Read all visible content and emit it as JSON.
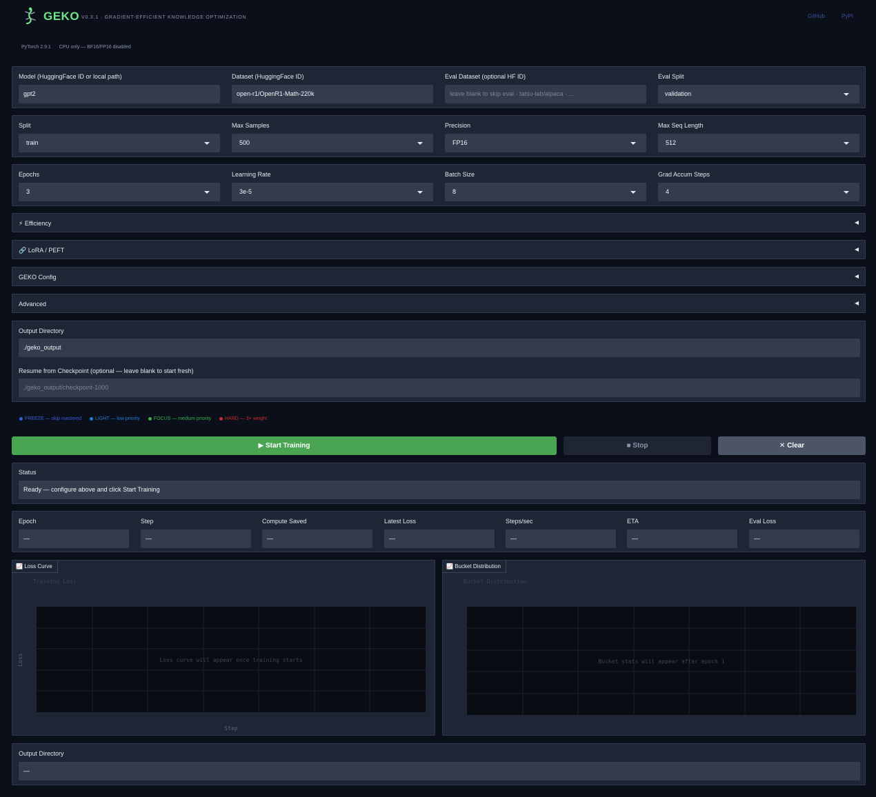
{
  "header": {
    "brand": "GEKO",
    "tagline": "V0.3.1 · GRADIENT-EFFICIENT KNOWLEDGE OPTIMIZATION",
    "links": [
      "GitHub",
      "PyPI"
    ],
    "logo_icon": "gecko-icon",
    "brand_color": "#6ee787"
  },
  "env": {
    "torch": "PyTorch 2.9.1",
    "device": "CPU only — BF16/FP16 disabled"
  },
  "row1": {
    "model": {
      "label": "Model (HuggingFace ID or local path)",
      "value": "gpt2"
    },
    "dataset": {
      "label": "Dataset (HuggingFace ID)",
      "value": "open-r1/OpenR1-Math-220k"
    },
    "eval_dataset": {
      "label": "Eval Dataset (optional HF ID)",
      "value": "",
      "placeholder": "leave blank to skip eval · tatsu-lab/alpaca · ..."
    },
    "eval_split": {
      "label": "Eval Split",
      "value": "validation"
    }
  },
  "row2": {
    "split": {
      "label": "Split",
      "value": "train"
    },
    "max_samples": {
      "label": "Max Samples",
      "value": "500"
    },
    "precision": {
      "label": "Precision",
      "value": "FP16"
    },
    "max_seq": {
      "label": "Max Seq Length",
      "value": "512"
    }
  },
  "row3": {
    "epochs": {
      "label": "Epochs",
      "value": "3"
    },
    "lr": {
      "label": "Learning Rate",
      "value": "3e-5"
    },
    "batch": {
      "label": "Batch Size",
      "value": "8"
    },
    "grad_accum": {
      "label": "Grad Accum Steps",
      "value": "4"
    }
  },
  "accordions": [
    {
      "icon": "⚡",
      "label": "Efficiency"
    },
    {
      "icon": "🔗",
      "label": "LoRA / PEFT"
    },
    {
      "icon": "",
      "label": "GEKO Config"
    },
    {
      "icon": "",
      "label": "Advanced"
    }
  ],
  "output": {
    "dir_label": "Output Directory",
    "dir_value": "./geko_output",
    "resume_label": "Resume from Checkpoint (optional — leave blank to start fresh)",
    "resume_placeholder": "./geko_output/checkpoint-1000"
  },
  "legend": [
    {
      "label": "FREEZE — skip mastered",
      "color": "#3b5bdb"
    },
    {
      "label": "LIGHT — low priority",
      "color": "#1c7ed6"
    },
    {
      "label": "FOCUS — medium priority",
      "color": "#37b24d"
    },
    {
      "label": "HARD — 3× weight",
      "color": "#c92a2a"
    }
  ],
  "buttons": {
    "start": "▶ Start Training",
    "stop": "■ Stop",
    "clear": "✕ Clear"
  },
  "status": {
    "label": "Status",
    "value": "Ready — configure above and click Start Training"
  },
  "metrics": [
    {
      "label": "Epoch",
      "value": "—"
    },
    {
      "label": "Step",
      "value": "—"
    },
    {
      "label": "Compute Saved",
      "value": "—"
    },
    {
      "label": "Latest Loss",
      "value": "—"
    },
    {
      "label": "Steps/sec",
      "value": "—"
    },
    {
      "label": "ETA",
      "value": "—"
    },
    {
      "label": "Eval Loss",
      "value": "—"
    }
  ],
  "plots": {
    "loss": {
      "tab": "Loss Curve",
      "title": "Training Loss",
      "xlabel": "Step",
      "ylabel": "Loss",
      "empty_msg": "Loss curve will appear once training starts"
    },
    "bucket": {
      "tab": "Bucket Distribution",
      "title": "Bucket Distribution",
      "empty_msg": "Bucket stats will appear after epoch 1"
    }
  },
  "output_result": {
    "label": "Output Directory",
    "value": "—"
  }
}
